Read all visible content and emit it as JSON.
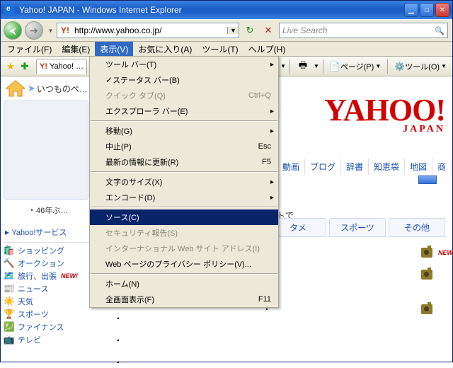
{
  "window": {
    "title": "Yahoo! JAPAN - Windows Internet Explorer"
  },
  "address": {
    "url": "http://www.yahoo.co.jp/",
    "search_placeholder": "Live Search"
  },
  "menubar": {
    "file": "ファイル(F)",
    "edit": "編集(E)",
    "view": "表示(V)",
    "favorites": "お気に入り(A)",
    "tools": "ツール(T)",
    "help": "ヘルプ(H)"
  },
  "view_menu": {
    "toolbars": "ツール バー(T)",
    "statusbar": "ステータス バー(B)",
    "quicktabs": "クイック タブ(Q)",
    "quicktabs_hot": "Ctrl+Q",
    "explorerbar": "エクスプローラ バー(E)",
    "goto": "移動(G)",
    "stop": "中止(P)",
    "stop_hot": "Esc",
    "refresh": "最新の情報に更新(R)",
    "refresh_hot": "F5",
    "textsize": "文字のサイズ(X)",
    "encoding": "エンコード(D)",
    "source": "ソース(C)",
    "security": "セキュリティ報告(S)",
    "intl": "インターナショナル Web サイト アドレス(I)",
    "privacy": "Web ページのプライバシー ポリシー(V)...",
    "home": "ホーム(N)",
    "fullscreen": "全画面表示(F)",
    "fullscreen_hot": "F11"
  },
  "tabs": {
    "tab0": "Yahoo! …"
  },
  "cmdbar": {
    "page": "ページ(P)",
    "tools": "ツール(O)"
  },
  "page": {
    "tagline": "いつものペ…",
    "snippet": "46年ぶ…",
    "mid_text": "トで",
    "logo": "YAHOO!",
    "logo_sub": "JAPAN"
  },
  "topnav": {
    "a": "動画",
    "b": "ブログ",
    "c": "辞書",
    "d": "知恵袋",
    "e": "地図",
    "f": "商"
  },
  "midtabs": {
    "a": "タメ",
    "b": "スポーツ",
    "c": "その他"
  },
  "sidebar": {
    "heading": "Yahoo!サービス",
    "items": [
      {
        "label": "ショッピング",
        "icon": "🛍️"
      },
      {
        "label": "オークション",
        "icon": "🔨"
      },
      {
        "label": "旅行、出張",
        "icon": "🗺️",
        "new": true
      },
      {
        "label": "ニュース",
        "icon": "📰"
      },
      {
        "label": "天気",
        "icon": "☀️"
      },
      {
        "label": "スポーツ",
        "icon": "🏆"
      },
      {
        "label": "ファイナンス",
        "icon": "💹"
      },
      {
        "label": "テレビ",
        "icon": "📺"
      }
    ]
  },
  "new_badge": "NEW!"
}
